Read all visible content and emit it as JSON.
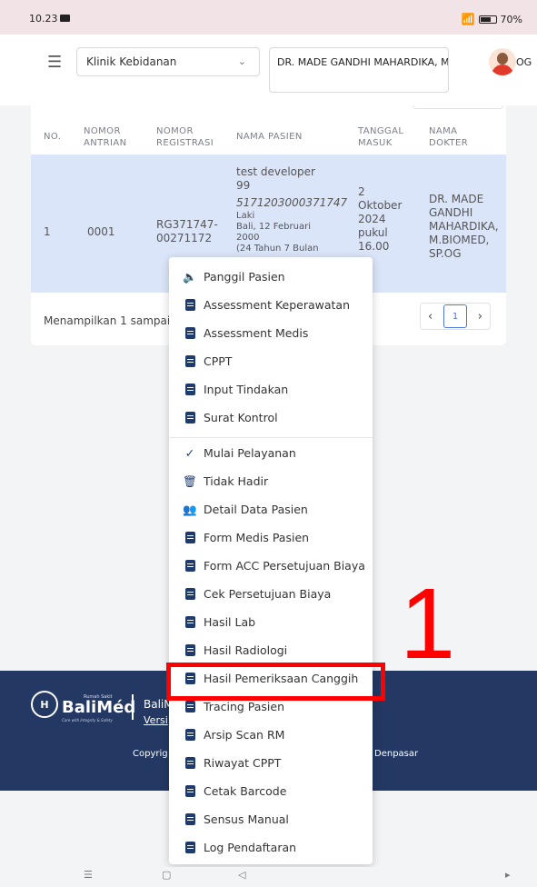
{
  "status": {
    "time": "10.23",
    "battery": "70%",
    "battery_level": 0.7
  },
  "topbar": {
    "clinic": "Klinik Kebidanan",
    "doctor": "DR. MADE GANDHI MAHARDIKA, M.BIOMED",
    "doctor_suffix": "OG"
  },
  "table": {
    "headers": {
      "no": "NO.",
      "nomor_antrian": "NOMOR ANTRIAN",
      "nomor_registrasi": "NOMOR REGISTRASI",
      "nama_pasien": "NAMA PASIEN",
      "tanggal_masuk": "TANGGAL MASUK",
      "nama_dokter": "NAMA DOKTER"
    },
    "row": {
      "no": "1",
      "nomor_antrian": "0001",
      "nomor_registrasi": "RG371747-00271172",
      "nama_pasien": "test developer 99",
      "nik": "5171203000371747",
      "gender": "Laki",
      "ttl": "Bali, 12 Februari 2000",
      "umur": "(24 Tahun 7 Bulan",
      "tanggal_masuk": "2 Oktober 2024 pukul 16.00",
      "nama_dokter": "DR. MADE GANDHI MAHARDIKA, M.BIOMED, SP.OG"
    },
    "showing": "Menampilkan 1 sampai",
    "page": "1"
  },
  "menu": {
    "items": [
      "Panggil Pasien",
      "Assessment Keperawatan",
      "Assessment Medis",
      "CPPT",
      "Input Tindakan",
      "Surat Kontrol",
      "Mulai Pelayanan",
      "Tidak Hadir",
      "Detail Data Pasien",
      "Form Medis Pasien",
      "Form ACC Persetujuan Biaya",
      "Cek Persetujuan Biaya",
      "Hasil Lab",
      "Hasil Radiologi",
      "Hasil Pemeriksaan Canggih",
      "Tracing Pasien",
      "Arsip Scan RM",
      "Riwayat CPPT",
      "Cetak Barcode",
      "Sensus Manual",
      "Log Pendaftaran"
    ]
  },
  "footer": {
    "logo_small": "Rumah Sakit",
    "logo_name": "BaliMéd",
    "logo_tagline": "Care with Integrity & Safety",
    "app_name": "BaliM",
    "version": "Versi",
    "copyright": "Copyrig",
    "location": "Denpasar"
  },
  "annotation": {
    "label": "1"
  }
}
